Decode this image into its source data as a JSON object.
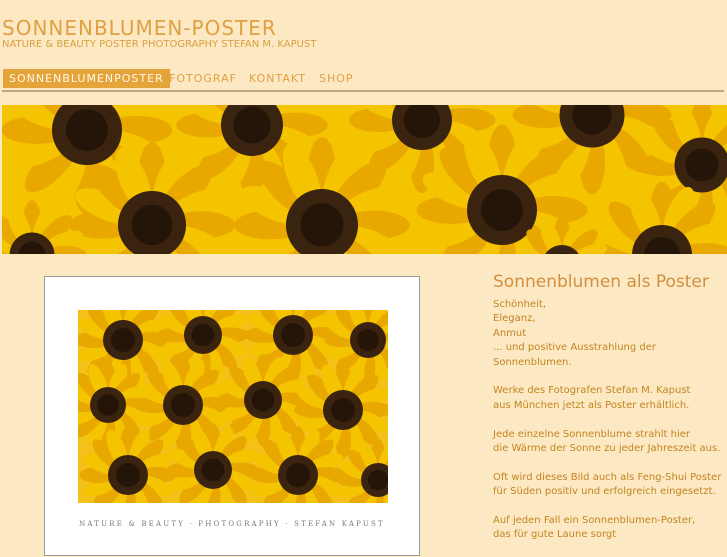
{
  "header": {
    "title": "SONNENBLUMEN-POSTER",
    "subtitle": "NATURE & BEAUTY POSTER PHOTOGRAPHY STEFAN M. KAPUST"
  },
  "nav": {
    "items": [
      {
        "label": "SONNENBLUMENPOSTER"
      },
      {
        "label": "FOTOGRAF"
      },
      {
        "label": "KONTAKT"
      },
      {
        "label": "SHOP"
      }
    ]
  },
  "poster": {
    "caption": "NATURE & BEAUTY · PHOTOGRAPHY · STEFAN KAPUST"
  },
  "sidebar": {
    "heading": "Sonnenblumen als Poster",
    "paragraphs": [
      [
        "Schönheit,",
        "Eleganz,",
        "Anmut",
        "... und positive Ausstrahlung der",
        "Sonnenblumen."
      ],
      [
        "Werke des Fotografen Stefan M. Kapust",
        "aus München jetzt als Poster erhältlich."
      ],
      [
        "Jede einzelne Sonnenblume strahlt hier",
        "die Wärme der Sonne zu jeder Jahreszeit aus."
      ],
      [
        "Oft wird dieses Bild auch als Feng-Shui Poster",
        "für Süden positiv und erfolgreich eingesetzt."
      ],
      [
        "Auf jeden Fall ein Sonnenblumen-Poster,",
        "das für gute Laune sorgt"
      ]
    ]
  },
  "colors": {
    "background": "#fde8c4",
    "accent": "#e5a43a",
    "petal": "#f5c400",
    "flower_center": "#3a2410"
  },
  "icons": [
    "sunflower-banner-image",
    "sunflower-poster-image"
  ]
}
